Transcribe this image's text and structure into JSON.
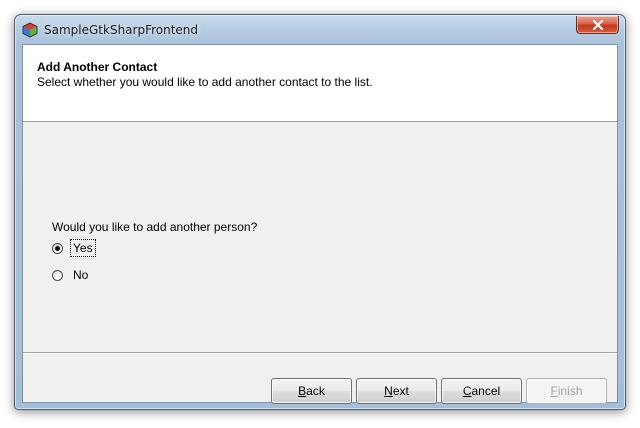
{
  "window": {
    "title": "SampleGtkSharpFrontend",
    "icon": "gtk-cube-icon",
    "close_icon": "close-icon"
  },
  "header": {
    "title": "Add Another Contact",
    "description": "Select whether you would like to add another contact to the list."
  },
  "question": {
    "text": "Would you like to add another person?",
    "options": [
      {
        "label": "Yes",
        "selected": true,
        "focused": true
      },
      {
        "label": "No",
        "selected": false,
        "focused": false
      }
    ]
  },
  "buttons": {
    "back": {
      "mnemonic": "B",
      "rest": "ack",
      "enabled": true
    },
    "next": {
      "mnemonic": "N",
      "rest": "ext",
      "enabled": true
    },
    "cancel": {
      "mnemonic": "C",
      "rest": "ancel",
      "enabled": true
    },
    "finish": {
      "mnemonic": "F",
      "rest": "inish",
      "enabled": false
    }
  },
  "colors": {
    "frame": "#a9c1da",
    "client_bg": "#f0f0f0",
    "close_button": "#c4391f"
  }
}
